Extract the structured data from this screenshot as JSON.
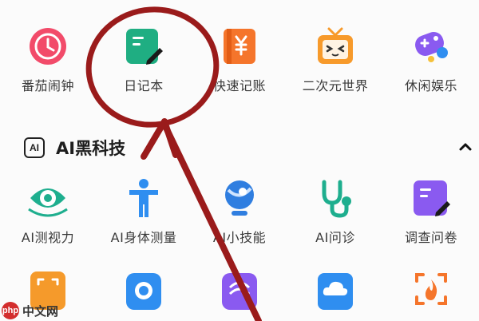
{
  "top_row": [
    {
      "label": "番茄闹钟",
      "icon": "tomato-clock-icon",
      "color": "#f24b6a"
    },
    {
      "label": "日记本",
      "icon": "diary-icon",
      "color": "#1fae82"
    },
    {
      "label": "快速记账",
      "icon": "ledger-icon",
      "color": "#f5752b"
    },
    {
      "label": "二次元世界",
      "icon": "tv-icon",
      "color": "#f79a2b"
    },
    {
      "label": "休闲娱乐",
      "icon": "gamepad-icon",
      "color": "#8a5af0"
    }
  ],
  "section": {
    "badge": "AI",
    "title": "AI黑科技"
  },
  "ai_row": [
    {
      "label": "AI测视力",
      "icon": "eye-icon",
      "color": "#1eae8e"
    },
    {
      "label": "AI身体测量",
      "icon": "body-icon",
      "color": "#2f8ef0"
    },
    {
      "label": "AI小技能",
      "icon": "globe-icon",
      "color": "#2f7ee0"
    },
    {
      "label": "AI问诊",
      "icon": "stethoscope-icon",
      "color": "#1eae8e"
    },
    {
      "label": "调查问卷",
      "icon": "survey-icon",
      "color": "#8a5af0"
    }
  ],
  "bottom_row": [
    {
      "icon": "scan-icon",
      "color": "#f59a2b"
    },
    {
      "icon": "camera-icon",
      "color": "#2f8ef0"
    },
    {
      "icon": "purple-tool-icon",
      "color": "#8a5af0"
    },
    {
      "icon": "cloud-icon",
      "color": "#2f8ef0"
    },
    {
      "icon": "fire-scan-icon",
      "color": "#f5752b"
    }
  ],
  "watermark": {
    "logo": "php",
    "text": "中文网"
  }
}
